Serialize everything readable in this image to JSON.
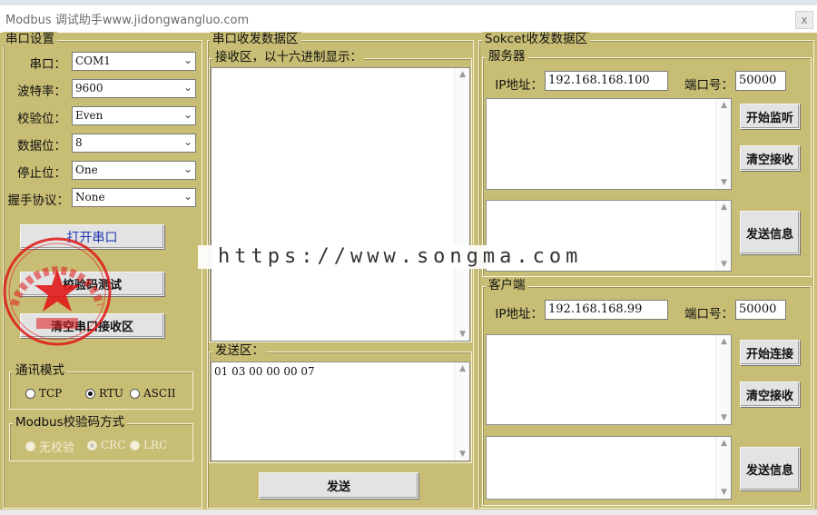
{
  "window": {
    "title": "Modbus 调试助手www.jidongwangluo.com",
    "close_label": "x"
  },
  "serial": {
    "title": "串口设置",
    "port_label": "串口：",
    "port_value": "COM1",
    "baud_label": "波特率：",
    "baud_value": "9600",
    "parity_label": "校验位：",
    "parity_value": "Even",
    "data_bits_label": "数据位：",
    "data_bits_value": "8",
    "stop_bits_label": "停止位：",
    "stop_bits_value": "One",
    "handshake_label": "握手协议：",
    "handshake_value": "None",
    "open_button": "打开串口",
    "checksum_button": "校验码测试",
    "clear_button": "清空串口接收区",
    "comm_mode_title": "通讯模式",
    "comm_modes": [
      {
        "label": "TCP",
        "selected": false
      },
      {
        "label": "RTU",
        "selected": true
      },
      {
        "label": "ASCII",
        "selected": false
      }
    ],
    "checksum_title": "Modbus校验码方式",
    "checksum_modes": [
      {
        "label": "无校验",
        "selected": false
      },
      {
        "label": "CRC",
        "selected": true
      },
      {
        "label": "LRC",
        "selected": false
      }
    ]
  },
  "serial_io": {
    "title": "串口收发数据区",
    "receive_title": "接收区，以十六进制显示：",
    "receive_text": "",
    "send_title": "发送区：",
    "send_text": "01 03 00 00 00 07",
    "send_button": "发送"
  },
  "socket": {
    "title": "Sokcet收发数据区",
    "server": {
      "title": "服务器",
      "ip_label": "IP地址：",
      "ip_value": "192.168.168.100",
      "port_label": "端口号：",
      "port_value": "50000",
      "listen_button": "开始监听",
      "clear_button": "清空接收",
      "send_button": "发送信息"
    },
    "client": {
      "title": "客户端",
      "ip_label": "IP地址：",
      "ip_value": "192.168.168.99",
      "port_label": "端口号：",
      "port_value": "50000",
      "connect_button": "开始连接",
      "clear_button": "清空接收",
      "send_button": "发送信息"
    }
  },
  "overlay": {
    "watermark": "https://www.songma.com",
    "seal_text": "网 赋 码 网 数 据 网 店"
  },
  "colors": {
    "background": "#c8bd74",
    "seal": "#e01919",
    "button": "#e3e3e3"
  }
}
